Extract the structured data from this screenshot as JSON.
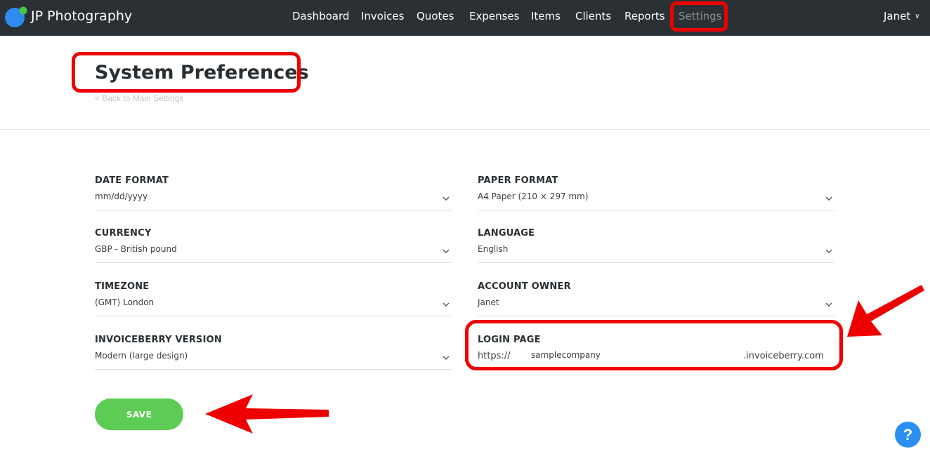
{
  "app": {
    "brand": "JP Photography"
  },
  "nav": {
    "items": [
      {
        "label": "Dashboard"
      },
      {
        "label": "Invoices"
      },
      {
        "label": "Quotes"
      },
      {
        "label": "Expenses"
      },
      {
        "label": "Items"
      },
      {
        "label": "Clients"
      },
      {
        "label": "Reports"
      },
      {
        "label": "Settings",
        "active": true
      }
    ],
    "user": "Janet"
  },
  "page": {
    "title": "System Preferences",
    "back_link": "< Back to Main Settings"
  },
  "form": {
    "date_format": {
      "label": "DATE FORMAT",
      "value": "mm/dd/yyyy"
    },
    "paper_format": {
      "label": "PAPER FORMAT",
      "value": "A4 Paper (210 × 297 mm)"
    },
    "currency": {
      "label": "CURRENCY",
      "value": "GBP - British pound"
    },
    "language": {
      "label": "LANGUAGE",
      "value": "English"
    },
    "timezone": {
      "label": "TIMEZONE",
      "value": "(GMT) London"
    },
    "account_owner": {
      "label": "ACCOUNT OWNER",
      "value": "Janet"
    },
    "version": {
      "label": "INVOICEBERRY VERSION",
      "value": "Modern (large design)"
    },
    "login_page": {
      "label": "LOGIN PAGE",
      "prefix": "https://",
      "subdomain": "samplecompany",
      "suffix": ".invoiceberry.com"
    }
  },
  "save_label": "SAVE",
  "help_label": "?",
  "colors": {
    "topbar": "#2b3035",
    "save": "#5ccc54",
    "highlight": "#ee0000",
    "help": "#2a8ff0"
  }
}
